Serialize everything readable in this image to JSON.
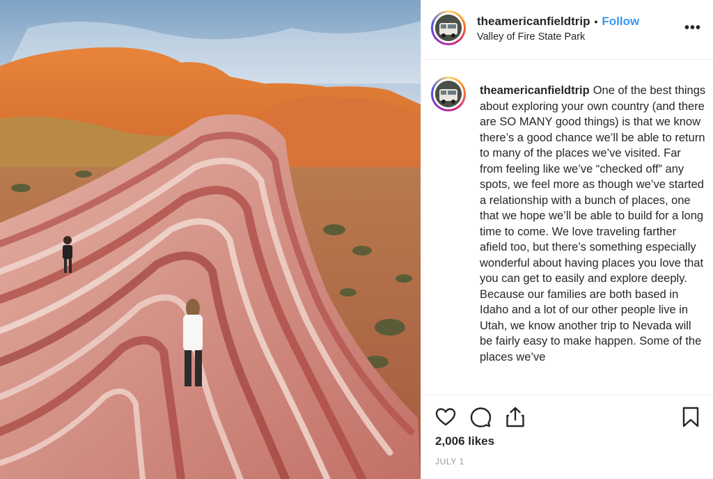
{
  "header": {
    "username": "theamericanfieldtrip",
    "separator": "•",
    "follow_label": "Follow",
    "location": "Valley of Fire State Park",
    "more_label": "•••",
    "avatar_icon": "avatar-profile-photo"
  },
  "caption": {
    "username": "theamericanfieldtrip",
    "text": "One of the best things about exploring your own country (and there are SO MANY good things) is that we know there’s a good chance we’ll be able to return to many of the places we’ve visited. Far from feeling like we’ve “checked off” any spots, we feel more as though we’ve started a relationship with a bunch of places, one that we hope we’ll be able to build for a long time to come. We love traveling farther afield too, but there’s something especially wonderful about having places you love that you can get to easily and explore deeply. Because our families are both based in Idaho and a lot of our other people live in Utah, we know another trip to Nevada will be fairly easy to make happen. Some of the places we’ve"
  },
  "actions": {
    "icons": [
      "heart-icon",
      "comment-icon",
      "share-icon",
      "bookmark-icon"
    ],
    "likes": "2,006 likes",
    "date": "JULY 1"
  },
  "colors": {
    "follow": "#3897f0",
    "text": "#262626",
    "muted": "#999999",
    "border": "#efefef"
  }
}
